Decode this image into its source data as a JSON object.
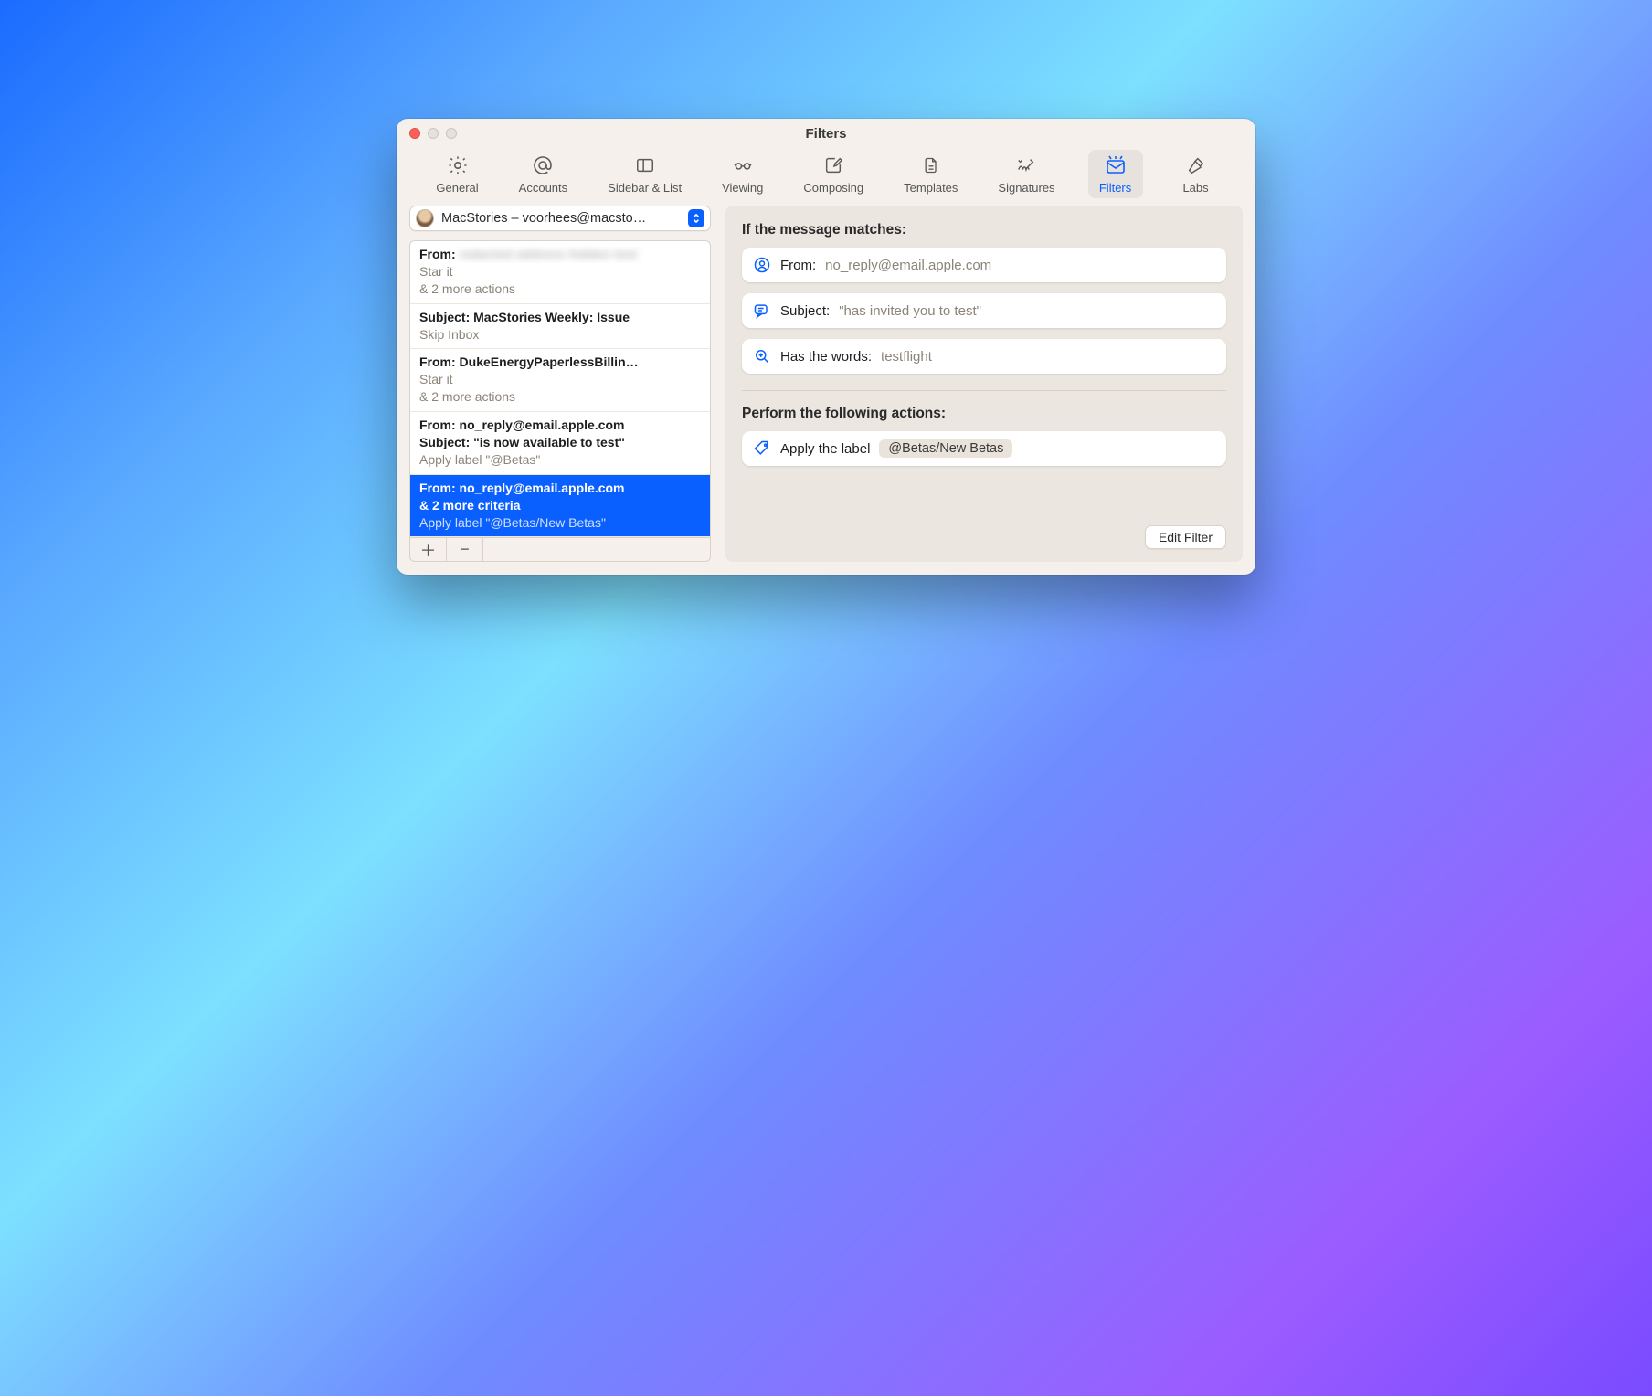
{
  "window": {
    "title": "Filters"
  },
  "toolbar": {
    "items": [
      {
        "label": "General"
      },
      {
        "label": "Accounts"
      },
      {
        "label": "Sidebar & List"
      },
      {
        "label": "Viewing"
      },
      {
        "label": "Composing"
      },
      {
        "label": "Templates"
      },
      {
        "label": "Signatures"
      },
      {
        "label": "Filters"
      },
      {
        "label": "Labs"
      }
    ],
    "active_index": 7
  },
  "account_selector": {
    "label": "MacStories – voorhees@macsto…"
  },
  "filters": [
    {
      "line1": "From: ",
      "redacted": true,
      "line2a": "Star it",
      "line2b": "& 2 more actions"
    },
    {
      "line1": "Subject: MacStories Weekly: Issue",
      "line2a": "Skip Inbox"
    },
    {
      "line1": "From: DukeEnergyPaperlessBillin…",
      "line2a": "Star it",
      "line2b": "& 2 more actions"
    },
    {
      "line1": "From: no_reply@email.apple.com",
      "line1b": "Subject: \"is now available to test\"",
      "line2a": "Apply label \"@Betas\""
    },
    {
      "line1": "From: no_reply@email.apple.com",
      "line1b": "& 2 more criteria",
      "line2a": "Apply label \"@Betas/New Betas\"",
      "selected": true
    }
  ],
  "detail": {
    "matches_title": "If the message matches:",
    "conditions": [
      {
        "label": "From:",
        "value": "no_reply@email.apple.com",
        "icon": "person"
      },
      {
        "label": "Subject:",
        "value": "\"has invited you to test\"",
        "icon": "chat"
      },
      {
        "label": "Has the words:",
        "value": "testflight",
        "icon": "search"
      }
    ],
    "actions_title": "Perform the following actions:",
    "actions": [
      {
        "label": "Apply the label",
        "chip": "@Betas/New Betas",
        "icon": "tag"
      }
    ],
    "edit_button": "Edit Filter"
  }
}
